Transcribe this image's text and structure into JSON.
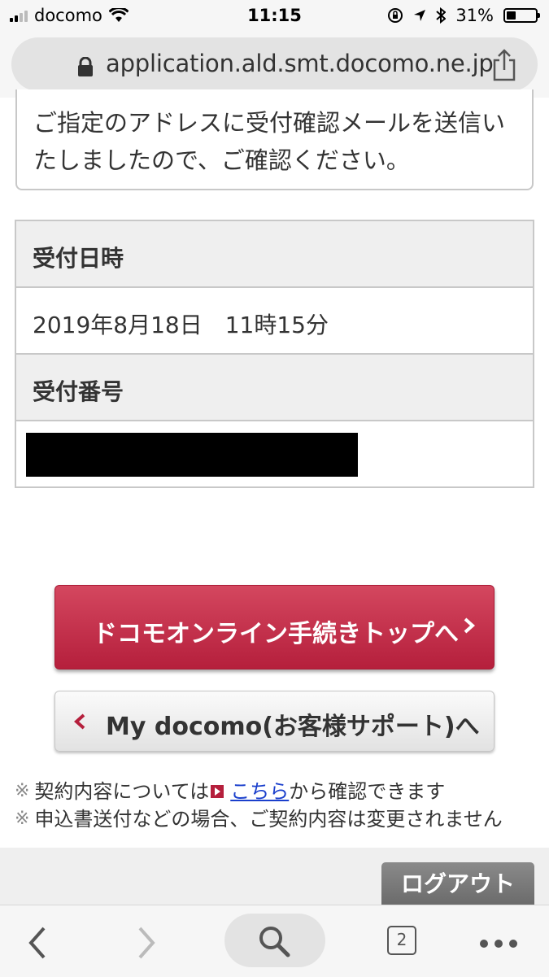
{
  "status_bar": {
    "carrier": "docomo",
    "time": "11:15",
    "battery": "31%",
    "battery_level": 0.31,
    "icons": [
      "signal-icon",
      "wifi-icon",
      "rotation-lock-icon",
      "location-icon",
      "bluetooth-icon",
      "battery-icon"
    ]
  },
  "browser": {
    "url": "application.ald.smt.docomo.ne.jp",
    "tab_count": "2"
  },
  "confirmation_message": "ご指定のアドレスに受付確認メールを送信いたしましたので、ご確認ください。",
  "info_table": {
    "date_label": "受付日時",
    "date_value": "2019年8月18日　11時15分",
    "number_label": "受付番号"
  },
  "buttons": {
    "online_top": "ドコモオンライン手続きトップへ",
    "my_docomo": "My docomo(お客様サポート)へ",
    "logout": "ログアウト"
  },
  "notes": {
    "mark": "※",
    "note1_before": "契約内容については",
    "note1_link": "こちら",
    "note1_after": "から確認できます",
    "note2": "申込書送付などの場合、ご契約内容は変更されません"
  },
  "colors": {
    "accent_red": "#b51f3c",
    "link_blue": "#1a3fcc"
  }
}
